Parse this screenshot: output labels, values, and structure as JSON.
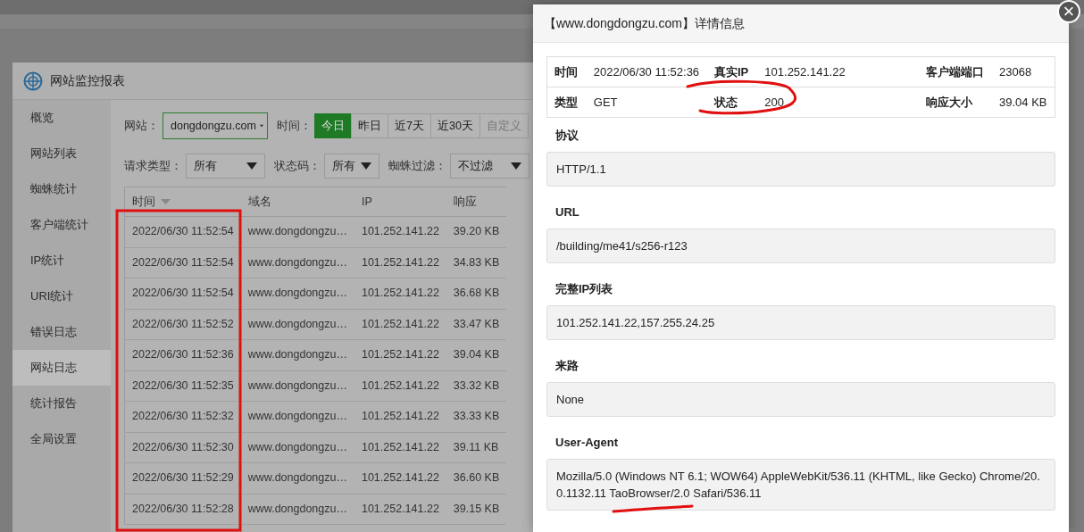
{
  "app": {
    "title": "网站监控报表",
    "sidebar": [
      {
        "label": "概览",
        "selected": false
      },
      {
        "label": "网站列表",
        "selected": false
      },
      {
        "label": "蜘蛛统计",
        "selected": false
      },
      {
        "label": "客户端统计",
        "selected": false
      },
      {
        "label": "IP统计",
        "selected": false
      },
      {
        "label": "URI统计",
        "selected": false
      },
      {
        "label": "错误日志",
        "selected": false
      },
      {
        "label": "网站日志",
        "selected": true
      },
      {
        "label": "统计报告",
        "selected": false
      },
      {
        "label": "全局设置",
        "selected": false
      }
    ],
    "filters": {
      "site_label": "网站：",
      "site_value": "dongdongzu.com",
      "time_label": "时间：",
      "time_tabs": [
        {
          "label": "今日",
          "selected": true
        },
        {
          "label": "昨日",
          "selected": false
        },
        {
          "label": "近7天",
          "selected": false
        },
        {
          "label": "近30天",
          "selected": false
        },
        {
          "label": "自定义",
          "selected": false
        }
      ],
      "request_type_label": "请求类型：",
      "request_type_value": "所有",
      "status_label": "状态码：",
      "status_value": "所有",
      "spider_label": "蜘蛛过滤：",
      "spider_value": "不过滤"
    },
    "table": {
      "columns": [
        "时间",
        "域名",
        "IP",
        "响应"
      ],
      "rows": [
        [
          "2022/06/30 11:52:54",
          "www.dongdongzu…",
          "101.252.141.22",
          "39.20 KB"
        ],
        [
          "2022/06/30 11:52:54",
          "www.dongdongzu…",
          "101.252.141.22",
          "34.83 KB"
        ],
        [
          "2022/06/30 11:52:54",
          "www.dongdongzu…",
          "101.252.141.22",
          "36.68 KB"
        ],
        [
          "2022/06/30 11:52:52",
          "www.dongdongzu…",
          "101.252.141.22",
          "33.47 KB"
        ],
        [
          "2022/06/30 11:52:36",
          "www.dongdongzu…",
          "101.252.141.22",
          "39.04 KB"
        ],
        [
          "2022/06/30 11:52:35",
          "www.dongdongzu…",
          "101.252.141.22",
          "33.32 KB"
        ],
        [
          "2022/06/30 11:52:32",
          "www.dongdongzu…",
          "101.252.141.22",
          "33.33 KB"
        ],
        [
          "2022/06/30 11:52:30",
          "www.dongdongzu…",
          "101.252.141.22",
          "39.11 KB"
        ],
        [
          "2022/06/30 11:52:29",
          "www.dongdongzu…",
          "101.252.141.22",
          "36.60 KB"
        ],
        [
          "2022/06/30 11:52:28",
          "www.dongdongzu…",
          "101.252.141.22",
          "39.15 KB"
        ]
      ]
    }
  },
  "detail": {
    "title": "【www.dongdongzu.com】详情信息",
    "close": "×",
    "info": [
      [
        {
          "label": "时间",
          "value": "2022/06/30 11:52:36"
        },
        {
          "label": "真实IP",
          "value": "101.252.141.22"
        },
        {
          "label": "客户端端口",
          "value": "23068"
        }
      ],
      [
        {
          "label": "类型",
          "value": "GET"
        },
        {
          "label": "状态",
          "value": "200"
        },
        {
          "label": "响应大小",
          "value": "39.04 KB"
        }
      ]
    ],
    "sections": [
      {
        "label": "协议",
        "value": "HTTP/1.1"
      },
      {
        "label": "URL",
        "value": "/building/me41/s256-r123"
      },
      {
        "label": "完整IP列表",
        "value": "101.252.141.22,157.255.24.25"
      },
      {
        "label": "来路",
        "value": "None"
      },
      {
        "label": "User-Agent",
        "value": "Mozilla/5.0 (Windows NT 6.1; WOW64) AppleWebKit/536.11 (KHTML, like Gecko) Chrome/20.0.1132.11 TaoBrowser/2.0 Safari/536.11"
      }
    ]
  }
}
